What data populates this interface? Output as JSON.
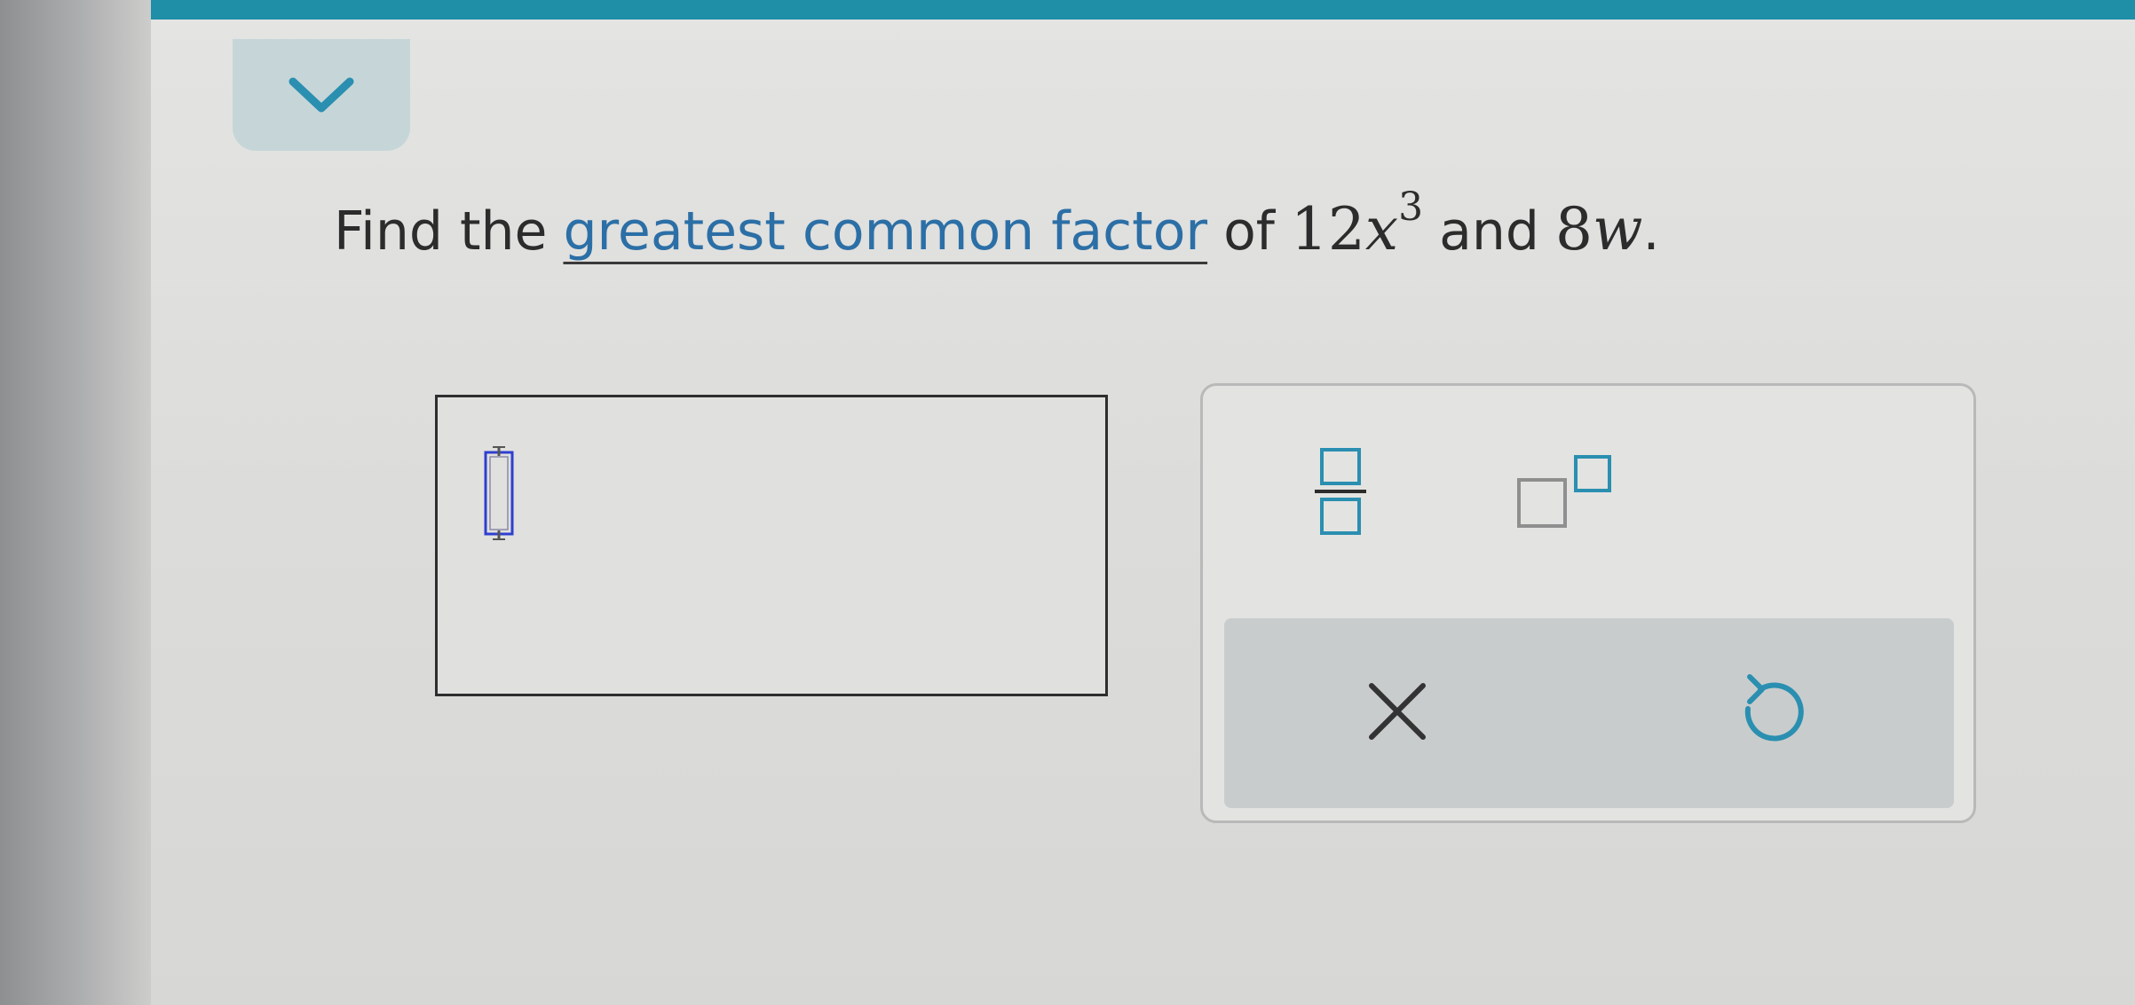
{
  "question": {
    "prefix": "Find the",
    "glossary_term": "greatest common factor",
    "of_text": "of",
    "term1_coef": "12",
    "term1_var": "x",
    "term1_exp": "3",
    "and_text": "and",
    "term2_coef": "8",
    "term2_var": "w",
    "period": "."
  },
  "colors": {
    "top_bar": "#1f8fa8",
    "link": "#2c6fa6",
    "icon_teal": "#2a8fb0",
    "cursor_blue": "#2f3fd0"
  },
  "palette": {
    "buttons": [
      "fraction-icon",
      "superscript-icon"
    ],
    "actions": [
      "clear-icon",
      "undo-icon"
    ]
  }
}
